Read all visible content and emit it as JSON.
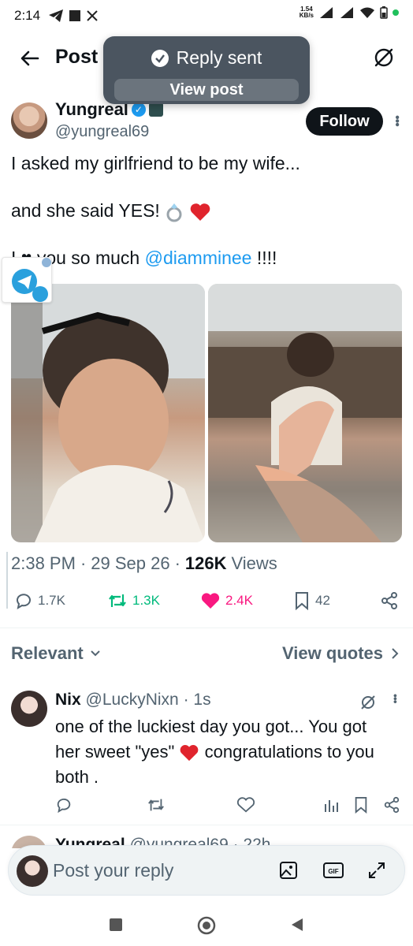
{
  "status_bar": {
    "time": "2:14",
    "net_speed_value": "1.54",
    "net_speed_unit": "KB/s"
  },
  "header": {
    "title": "Post",
    "back_icon": "back-arrow-icon",
    "grok_icon": "grok-icon"
  },
  "toast": {
    "message": "Reply sent",
    "action": "View post"
  },
  "post": {
    "display_name": "Yungreal",
    "handle": "@yungreal69",
    "follow_label": "Follow",
    "line1": "I asked my girlfriend to be my wife...",
    "line2": "and she said YES!",
    "line3_prefix": "I ♥ you so much",
    "mention": "@diamminee",
    "line3_suffix": "!!!!",
    "time": "2:38 PM",
    "date": "29 Sep 26",
    "views_count": "126K",
    "views_label": "Views",
    "replies": "1.7K",
    "reposts": "1.3K",
    "likes": "2.4K",
    "bookmarks": "42"
  },
  "sort": {
    "relevant_label": "Relevant",
    "view_quotes_label": "View quotes"
  },
  "reply": {
    "name": "Nix",
    "handle": "@LuckyNixn",
    "time": "· 1s",
    "text_part1": "one of the luckiest day you got... You got her sweet \"yes\"",
    "text_part2": "congratulations to you both ."
  },
  "peek": {
    "name": "Yungreal",
    "handle": "@yungreal69",
    "time": "· 22h"
  },
  "composer": {
    "placeholder": "Post your reply"
  },
  "colors": {
    "accent": "#1d9bf0",
    "like": "#f91880",
    "repost": "#00ba7c",
    "muted": "#536471",
    "toast_bg": "#4b5560"
  }
}
